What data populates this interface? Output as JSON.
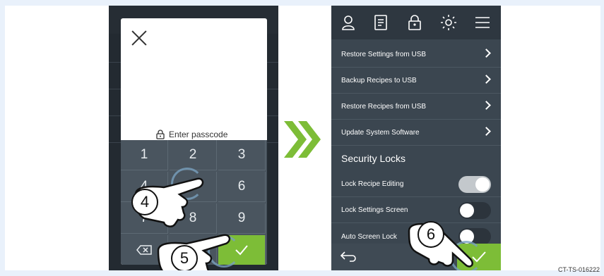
{
  "figure": {
    "caption": "CT-TS-016222"
  },
  "left_screen": {
    "passcode_placeholder": "Enter passcode",
    "keys": [
      "1",
      "2",
      "3",
      "4",
      "5",
      "6",
      "7",
      "8",
      "9"
    ],
    "step_badges": [
      "4",
      "5"
    ]
  },
  "right_screen": {
    "top_icons": [
      "user-icon",
      "recipe-icon",
      "lock-icon",
      "brightness-icon",
      "menu-icon"
    ],
    "list_items": [
      {
        "label": "Restore Settings from USB"
      },
      {
        "label": "Backup Recipes to USB"
      },
      {
        "label": "Restore Recipes from USB"
      },
      {
        "label": "Update System Software"
      }
    ],
    "section_title": "Security Locks",
    "toggles": [
      {
        "label": "Lock Recipe Editing",
        "state": "on"
      },
      {
        "label": "Lock Settings Screen",
        "state": "off"
      },
      {
        "label": "Auto Screen Lock",
        "state": "off"
      }
    ],
    "step_badge": "6"
  },
  "colors": {
    "accent_green": "#7dbd37",
    "panel_dark": "#3b4650",
    "arrow_green": "#7dbd37"
  }
}
